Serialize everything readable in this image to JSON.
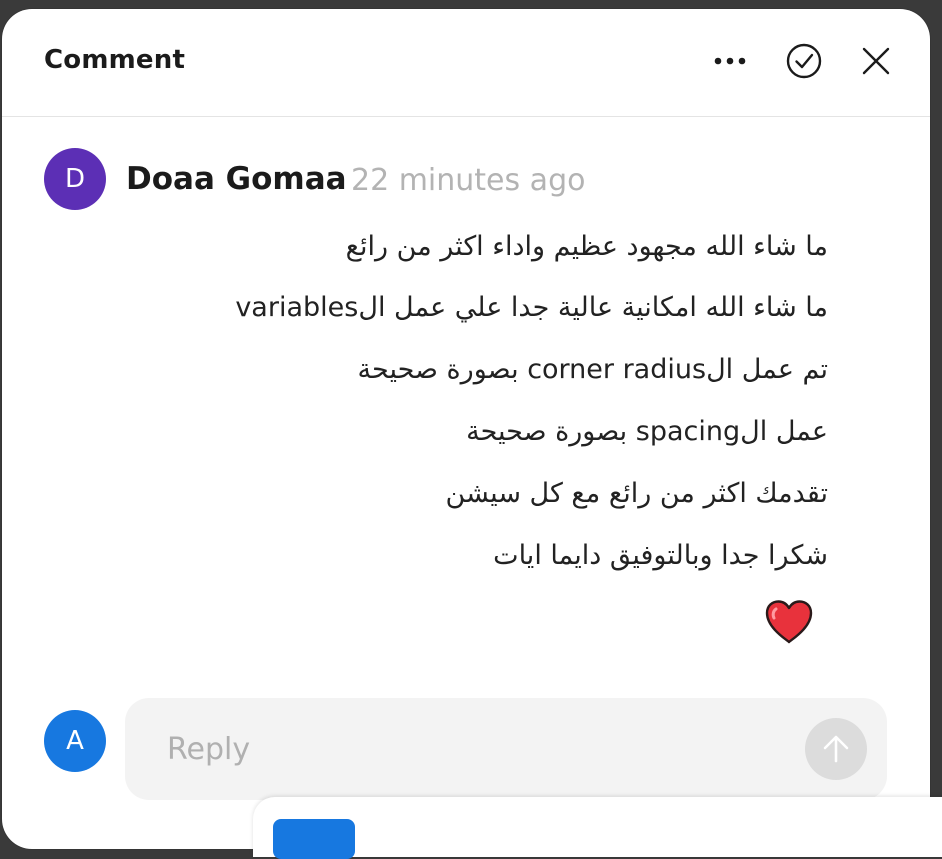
{
  "header": {
    "title": "Comment",
    "more_icon": "more-horizontal-icon",
    "resolve_icon": "check-circle-icon",
    "close_icon": "close-icon"
  },
  "comment": {
    "avatar_letter": "D",
    "avatar_color": "#5c2fb5",
    "author": "Doaa Gomaa",
    "timestamp": "22 minutes ago",
    "lines": [
      "ما شاء الله مجهود عظيم واداء اكثر من رائع",
      "ما شاء الله امكانية عالية جدا علي عمل الvariables",
      "تم عمل الcorner radius بصورة صحيحة",
      "عمل الspacing بصورة صحيحة",
      "تقدمك اكثر من رائع مع كل سيشن",
      "شكرا جدا وبالتوفيق دايما ايات"
    ],
    "emoji": "heart-icon"
  },
  "reply": {
    "avatar_letter": "A",
    "avatar_color": "#1778e0",
    "placeholder": "Reply",
    "send_icon": "arrow-up-icon"
  }
}
